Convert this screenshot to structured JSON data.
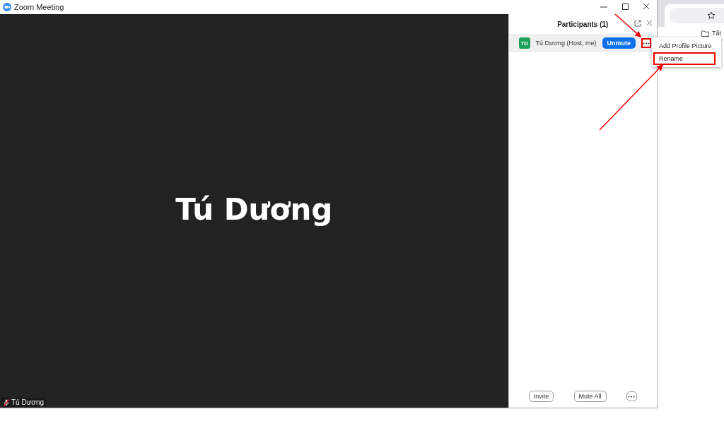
{
  "window": {
    "title": "Zoom Meeting"
  },
  "video": {
    "display_name": "Tú Dương",
    "name_tag": "Tú Dương",
    "muted": true
  },
  "participants_panel": {
    "title": "Participants (1)",
    "participants": [
      {
        "initials": "TD",
        "name": "Tú Dương (Host, me)",
        "action": "Unmute",
        "selected": true
      }
    ],
    "footer_buttons": [
      "Invite",
      "Mute All"
    ]
  },
  "context_menu": {
    "items": [
      {
        "label": "Add Profile Picture",
        "highlighted": false
      },
      {
        "label": "Rename",
        "highlighted": true
      }
    ]
  },
  "browser": {
    "bookmark": "Tất"
  }
}
